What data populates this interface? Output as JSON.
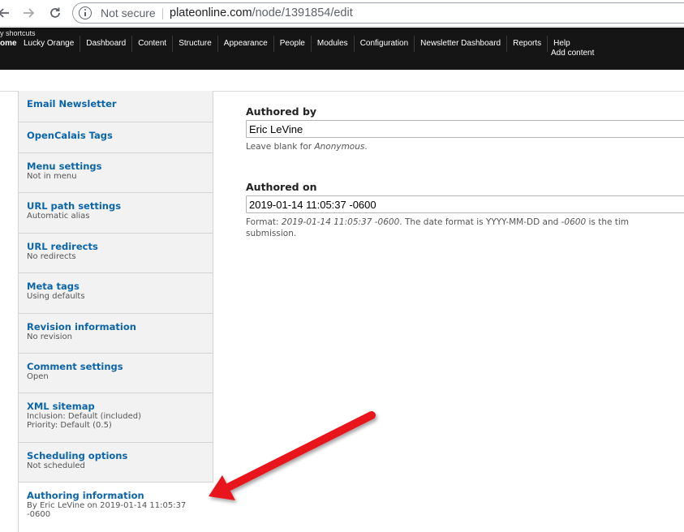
{
  "browser": {
    "security_label": "Not secure",
    "url_host": "plateonline.com",
    "url_path": "/node/1391854/edit"
  },
  "admin_toolbar": {
    "shortcuts_label": "y shortcuts",
    "home_label": "ome",
    "menu_items": [
      "Lucky Orange",
      "Dashboard",
      "Content",
      "Structure",
      "Appearance",
      "People",
      "Modules",
      "Configuration",
      "Newsletter Dashboard",
      "Reports",
      "Help"
    ],
    "add_content_label": "Add content"
  },
  "vertical_tabs": [
    {
      "title": "Email Newsletter",
      "summary": ""
    },
    {
      "title": "OpenCalais Tags",
      "summary": ""
    },
    {
      "title": "Menu settings",
      "summary": "Not in menu"
    },
    {
      "title": "URL path settings",
      "summary": "Automatic alias"
    },
    {
      "title": "URL redirects",
      "summary": "No redirects"
    },
    {
      "title": "Meta tags",
      "summary": "Using defaults"
    },
    {
      "title": "Revision information",
      "summary": "No revision"
    },
    {
      "title": "Comment settings",
      "summary": "Open"
    },
    {
      "title": "XML sitemap",
      "summary": "Inclusion: Default (included)",
      "summary2": "Priority: Default (0.5)"
    },
    {
      "title": "Scheduling options",
      "summary": "Not scheduled"
    },
    {
      "title": "Authoring information",
      "summary": "By Eric LeVine on 2019-01-14 11:05:37",
      "summary2": "-0600"
    }
  ],
  "authoring": {
    "authored_by_label": "Authored by",
    "authored_by_value": "Eric LeVine",
    "authored_by_help_prefix": "Leave blank for ",
    "authored_by_help_em": "Anonymous",
    "authored_by_help_suffix": ".",
    "authored_on_label": "Authored on",
    "authored_on_value": "2019-01-14 11:05:37 -0600",
    "format_prefix": "Format: ",
    "format_example": "2019-01-14 11:05:37 -0600",
    "format_middle": ". The date format is YYYY-MM-DD and ",
    "format_offset": "-0600",
    "format_suffix": " is the tim",
    "format_line2": "submission."
  },
  "colors": {
    "admin_bar_bg": "#151515",
    "link_blue": "#0b65a8",
    "arrow_red": "#e8141b"
  }
}
